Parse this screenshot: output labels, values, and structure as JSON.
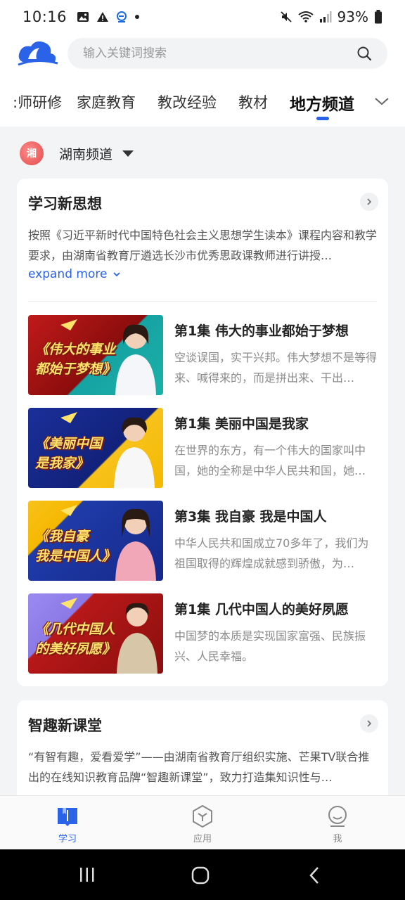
{
  "status_bar": {
    "time": "10:16",
    "battery": "93%"
  },
  "search": {
    "placeholder": "输入关键词搜索"
  },
  "tabs": [
    {
      "label": ":师研修"
    },
    {
      "label": "家庭教育"
    },
    {
      "label": "教改经验"
    },
    {
      "label": "教材"
    },
    {
      "label": "地方频道",
      "active": true
    }
  ],
  "region": {
    "badge": "湘",
    "label": "湖南频道"
  },
  "section1": {
    "title": "学习新思想",
    "description": "按照《习近平新时代中国特色社会主义思想学生读本》课程内容和教学要求，由湖南省教育厅遴选长沙市优秀思政课教师进行讲授…",
    "expand_label": "expand more",
    "episodes": [
      {
        "title": "第1集 伟大的事业都始于梦想",
        "description": "空谈误国，实干兴邦。伟大梦想不是等得来、喊得来的，而是拼出来、干出…",
        "thumb_line1": "《伟大的事业",
        "thumb_line2": "都始于梦想》"
      },
      {
        "title": "第1集 美丽中国是我家",
        "description": "在世界的东方，有一个伟大的国家叫中国，她的全称是中华人民共和国，她…",
        "thumb_line1": "《美丽中国",
        "thumb_line2": "是我家》"
      },
      {
        "title": "第3集 我自豪 我是中国人",
        "description": "中华人民共和国成立70多年了，我们为祖国取得的辉煌成就感到骄傲，为…",
        "thumb_line1": "《我自豪",
        "thumb_line2": "我是中国人》"
      },
      {
        "title": "第1集 几代中国人的美好夙愿",
        "description": "中国梦的本质是实现国家富强、民族振兴、人民幸福。",
        "thumb_line1": "《几代中国人",
        "thumb_line2": "的美好夙愿》"
      }
    ]
  },
  "section2": {
    "title": "智趣新课堂",
    "description": "“有智有趣，爱看爱学”——由湖南省教育厅组织实施、芒果TV联合推出的在线知识教育品牌“智趣新课堂”，致力打造集知识性与…"
  },
  "bottom_nav": [
    {
      "label": "学习",
      "active": true
    },
    {
      "label": "应用"
    },
    {
      "label": "我"
    }
  ],
  "colors": {
    "accent": "#2a62e8",
    "background": "#f3f4f6"
  }
}
